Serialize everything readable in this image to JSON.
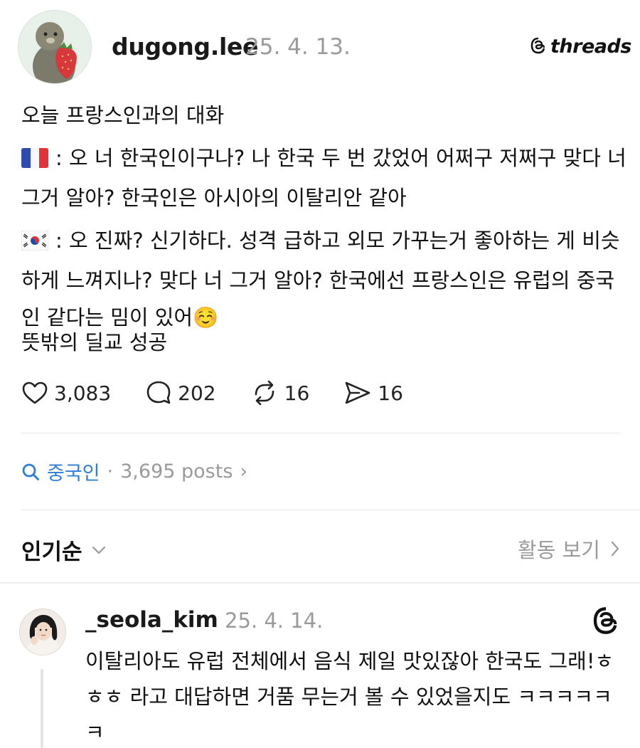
{
  "post": {
    "username": "dugong.lee",
    "date": "25. 4. 13.",
    "brand": "threads",
    "intro": "오늘 프랑스인과의 대화",
    "line_fr": ": 오 너 한국인이구나? 나 한국 두 번 갔었어 어쩌구 저쩌구 맞다 너 그거 알아? 한국인은 아시아의 이탈리안 같아",
    "line_kr": ": 오 진짜? 신기하다. 성격 급하고 외모 가꾸는거 좋아하는 게 비슷하게 느껴지나? 맞다 너 그거 알아? 한국에선 프랑스인은 유럽의 중국인 같다는 밈이 있어",
    "emoji": "☺️",
    "closing": "뜻밖의 딜교 성공",
    "stats": {
      "likes": "3,083",
      "comments": "202",
      "reposts": "16",
      "shares": "16"
    }
  },
  "topic": {
    "name": "중국인",
    "separator": "·",
    "count": "3,695 posts",
    "chevron": "›"
  },
  "sort": {
    "label": "인기순",
    "activity": "활동 보기"
  },
  "reply": {
    "username": "_seola_kim",
    "date": "25. 4. 14.",
    "text": "이탈리아도 유럽 전체에서 음식 제일 맛있잖아 한국도 그래!ㅎㅎㅎ 라고 대답하면 거품 무는거 볼 수 있었을지도 ㅋㅋㅋㅋㅋㅋ"
  },
  "icons": {
    "flag_fr": "flag-france-icon",
    "flag_kr": "flag-korea-icon",
    "like": "heart-icon",
    "comment": "comment-bubble-icon",
    "repost": "repost-icon",
    "share": "send-icon",
    "search": "search-icon",
    "threads": "threads-logo-icon"
  },
  "colors": {
    "accent": "#2f7fd6",
    "muted": "#9a9a9a",
    "text": "#111111"
  }
}
